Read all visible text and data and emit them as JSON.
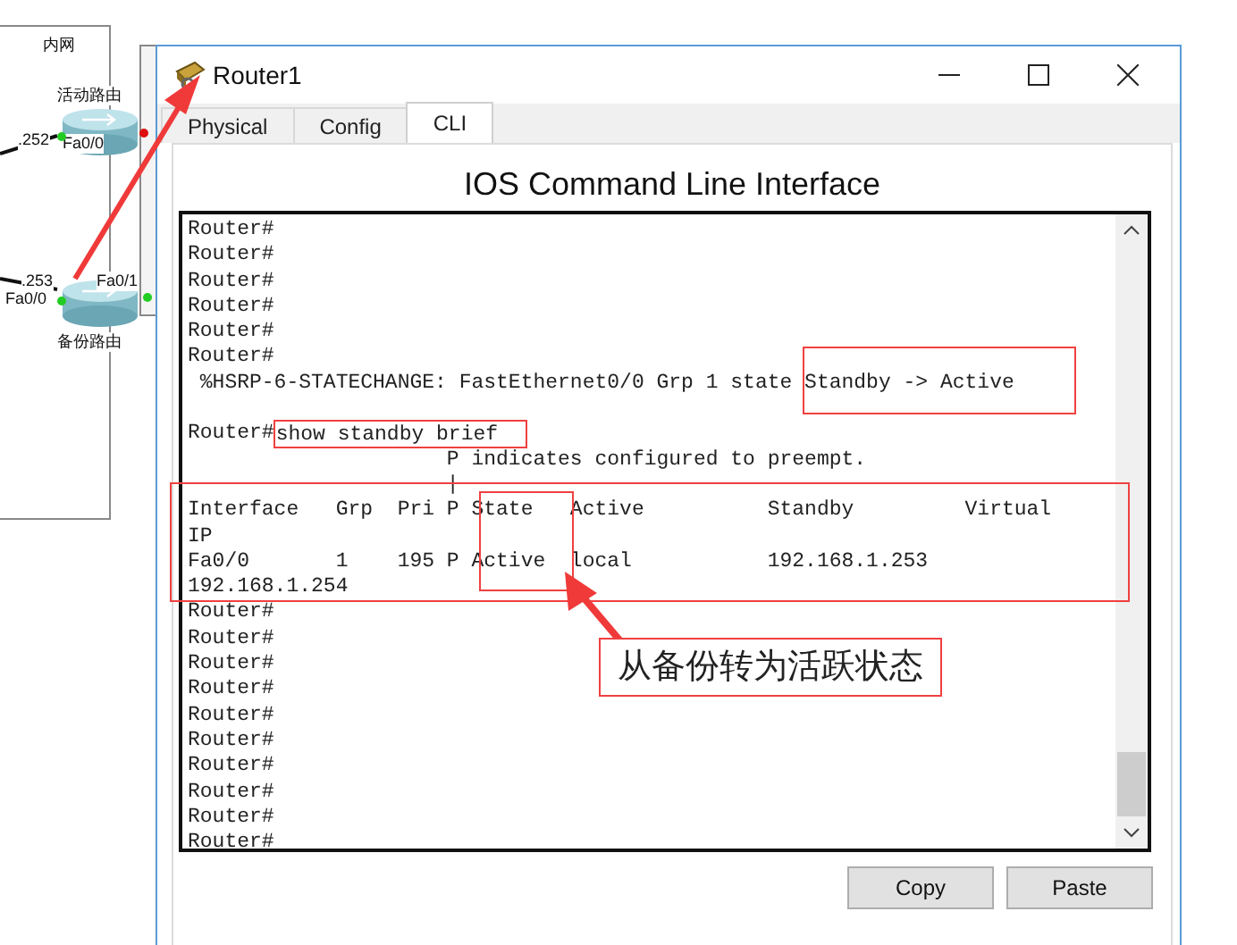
{
  "topology": {
    "area_label": "内网",
    "routers": [
      {
        "name": "活动路由",
        "address": ".252",
        "ports": [
          "Fa0/0"
        ]
      },
      {
        "name": "备份路由",
        "address": ".253",
        "ports": [
          "Fa0/0",
          "Fa0/1"
        ]
      }
    ]
  },
  "window": {
    "title": "Router1"
  },
  "tabs": [
    {
      "label": "Physical",
      "selected": false
    },
    {
      "label": "Config",
      "selected": false
    },
    {
      "label": "CLI",
      "selected": true
    }
  ],
  "cli": {
    "heading": "IOS Command Line Interface",
    "lines": [
      {
        "kind": "text",
        "text": "Router#"
      },
      {
        "kind": "text",
        "text": "Router#"
      },
      {
        "kind": "text",
        "text": "Router#"
      },
      {
        "kind": "text",
        "text": "Router#"
      },
      {
        "kind": "text",
        "text": "Router#"
      },
      {
        "kind": "text",
        "text": "Router#"
      },
      {
        "kind": "text",
        "text": " %HSRP-6-STATECHANGE: FastEthernet0/0 Grp 1 state Standby -> Active"
      },
      {
        "kind": "blank"
      },
      {
        "kind": "command",
        "prompt": "Router#",
        "command": "show standby brief"
      },
      {
        "kind": "text",
        "text": "                     P indicates configured to preempt."
      },
      {
        "kind": "text",
        "text": "                     |"
      },
      {
        "kind": "text",
        "text": "Interface   Grp  Pri P State   Active          Standby         Virtual"
      },
      {
        "kind": "text",
        "text": "IP"
      },
      {
        "kind": "text",
        "text": "Fa0/0       1    195 P Active  local           192.168.1.253"
      },
      {
        "kind": "text",
        "text": "192.168.1.254"
      },
      {
        "kind": "text",
        "text": "Router#"
      },
      {
        "kind": "text",
        "text": "Router#"
      },
      {
        "kind": "text",
        "text": "Router#"
      },
      {
        "kind": "text",
        "text": "Router#"
      },
      {
        "kind": "text",
        "text": "Router#"
      },
      {
        "kind": "text",
        "text": "Router#"
      },
      {
        "kind": "text",
        "text": "Router#"
      },
      {
        "kind": "text",
        "text": "Router#"
      },
      {
        "kind": "text",
        "text": "Router#"
      },
      {
        "kind": "text",
        "text": "Router#"
      }
    ]
  },
  "buttons": [
    "Copy",
    "Paste"
  ],
  "annotation": {
    "note": "从备份转为活跃状态"
  }
}
